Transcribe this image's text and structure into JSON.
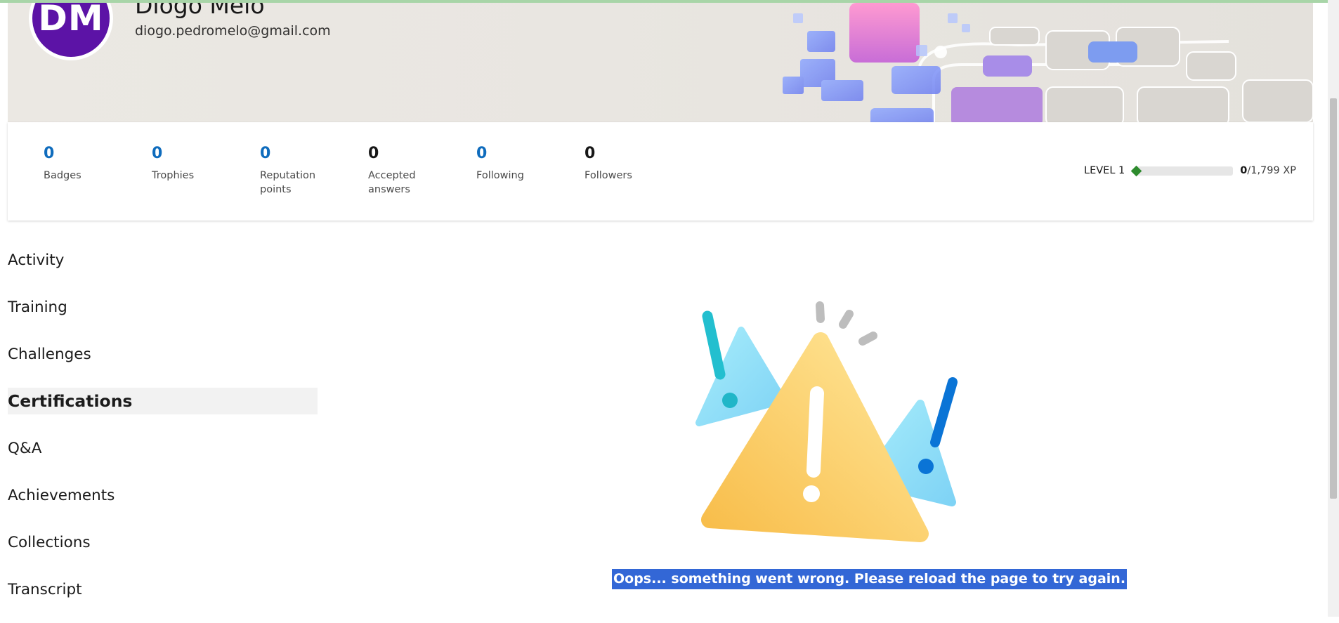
{
  "profile": {
    "initials": "DM",
    "name": "Diogo Melo",
    "email": "diogo.pedromelo@gmail.com"
  },
  "stats": [
    {
      "value": "0",
      "label": "Badges"
    },
    {
      "value": "0",
      "label": "Trophies"
    },
    {
      "value": "0",
      "label": "Reputation points"
    },
    {
      "value": "0",
      "label": "Accepted answers"
    },
    {
      "value": "0",
      "label": "Following"
    },
    {
      "value": "0",
      "label": "Followers"
    }
  ],
  "level": {
    "label": "LEVEL 1",
    "xp_current": "0",
    "xp_total": "/1,799 XP",
    "progress": 0
  },
  "nav": {
    "items": [
      {
        "label": "Activity"
      },
      {
        "label": "Training"
      },
      {
        "label": "Challenges"
      },
      {
        "label": "Certifications"
      },
      {
        "label": "Q&A"
      },
      {
        "label": "Achievements"
      },
      {
        "label": "Collections"
      },
      {
        "label": "Transcript"
      }
    ],
    "active": "Certifications"
  },
  "error": {
    "message": "Oops... something went wrong. Please reload the page to try again.",
    "icon": "warning-triangle-icon"
  },
  "colors": {
    "accent": "#0f6cbd",
    "avatar": "#5c13a6",
    "level_diamond": "#2e8b2e",
    "selection": "#3367d6"
  }
}
